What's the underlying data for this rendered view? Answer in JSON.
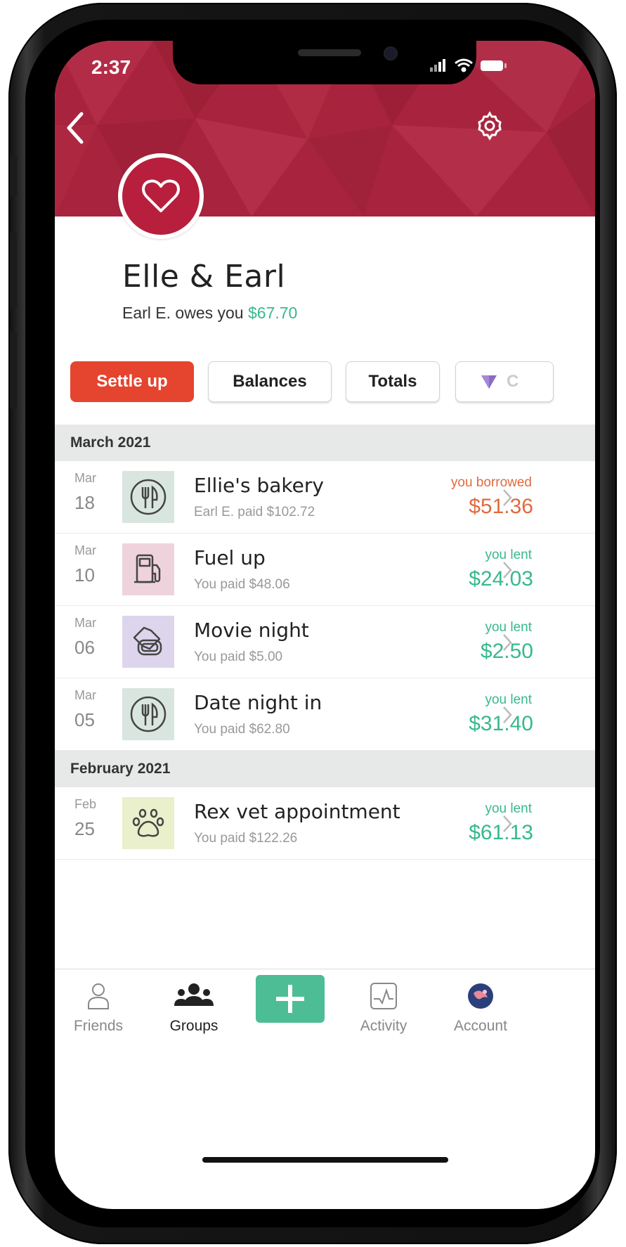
{
  "status_bar": {
    "time": "2:37"
  },
  "header": {
    "accent_color": "#a8243e",
    "back_icon": "chevron-left-icon",
    "settings_icon": "gear-icon"
  },
  "group": {
    "name": "Elle & Earl",
    "avatar_icon": "heart-icon",
    "balance_prefix": "Earl E. owes you",
    "balance_amount": "$67.70"
  },
  "actions": {
    "settle_up": "Settle up",
    "balances": "Balances",
    "totals": "Totals",
    "charts_partial": "C"
  },
  "sections": [
    {
      "month": "March 2021",
      "expenses": [
        {
          "month": "Mar",
          "day": "18",
          "icon": "cutlery-icon",
          "title": "Ellie's bakery",
          "subtitle": "Earl E. paid $102.72",
          "kind": "you borrowed",
          "amount": "$51.36",
          "status": "borrowed"
        },
        {
          "month": "Mar",
          "day": "10",
          "icon": "fuel-pump-icon",
          "title": "Fuel up",
          "subtitle": "You paid $48.06",
          "kind": "you lent",
          "amount": "$24.03",
          "status": "lent"
        },
        {
          "month": "Mar",
          "day": "06",
          "icon": "tickets-icon",
          "title": "Movie night",
          "subtitle": "You paid $5.00",
          "kind": "you lent",
          "amount": "$2.50",
          "status": "lent"
        },
        {
          "month": "Mar",
          "day": "05",
          "icon": "cutlery-icon",
          "title": "Date night in",
          "subtitle": "You paid $62.80",
          "kind": "you lent",
          "amount": "$31.40",
          "status": "lent"
        }
      ]
    },
    {
      "month": "February 2021",
      "expenses": [
        {
          "month": "Feb",
          "day": "25",
          "icon": "paw-icon",
          "title": "Rex vet appointment",
          "subtitle": "You paid $122.26",
          "kind": "you lent",
          "amount": "$61.13",
          "status": "lent"
        }
      ]
    }
  ],
  "tab_bar": {
    "friends": "Friends",
    "groups": "Groups",
    "add_icon": "plus-icon",
    "activity": "Activity",
    "account": "Account",
    "active_tab": "Groups"
  },
  "colors": {
    "settle_button": "#e5442e",
    "lent": "#38b88f",
    "borrowed": "#e06a3f",
    "add_button": "#4dbd95"
  }
}
